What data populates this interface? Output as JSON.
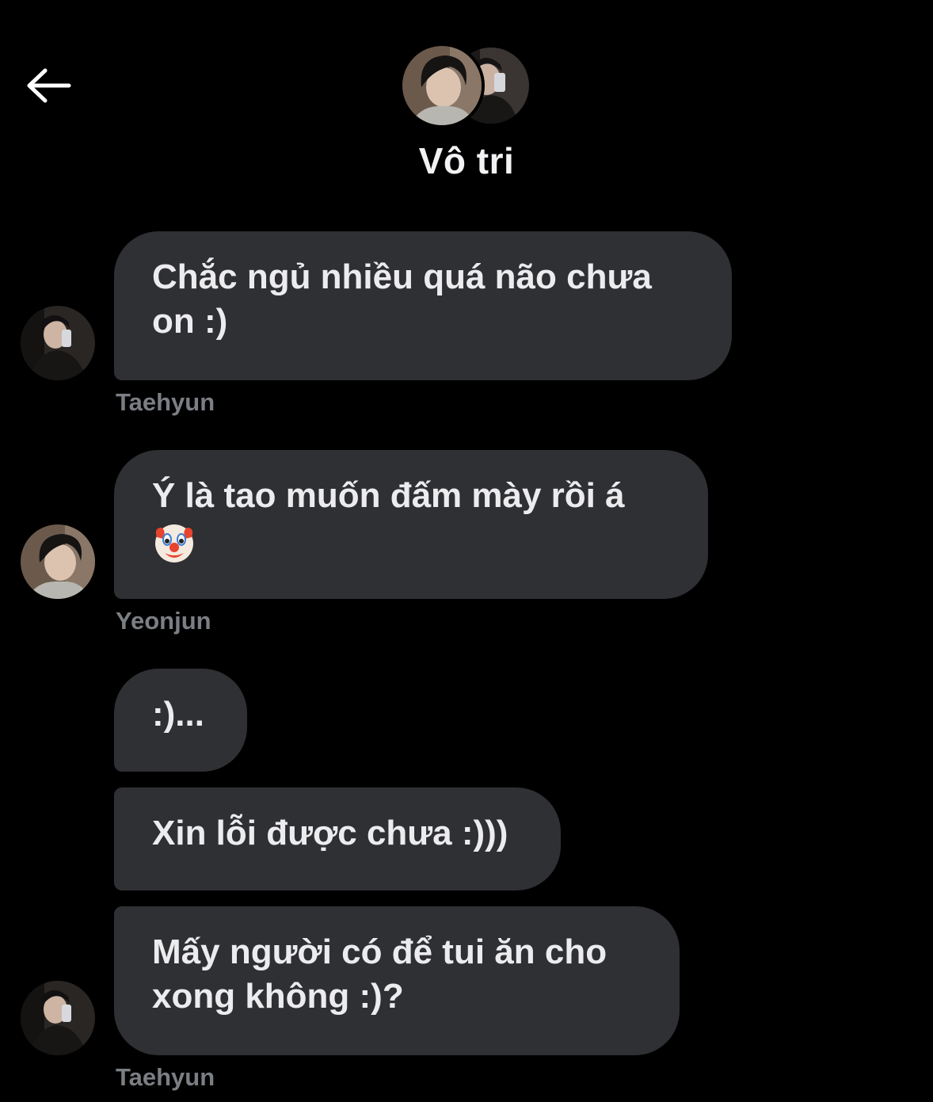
{
  "header": {
    "back_icon": "arrow-left-icon",
    "group_name": "Vô tri"
  },
  "colors": {
    "background": "#000000",
    "bubble": "#2f3033",
    "bubble_text": "#ececee",
    "sender_name": "#7b7e83"
  },
  "messages": [
    {
      "sender": "Taehyun",
      "lines": [
        "Chắc ngủ nhiều quá não chưa",
        "on :)"
      ]
    },
    {
      "sender": "Yeonjun",
      "lines": [
        "Ý là tao muốn đấm mày rồi á",
        ""
      ],
      "emoji": "clown-face-emoji"
    },
    {
      "sender": "Taehyun",
      "lines": [
        ":)..."
      ]
    },
    {
      "sender": "Taehyun",
      "lines": [
        "Xin lỗi được chưa :)))"
      ]
    },
    {
      "sender": "Taehyun",
      "lines": [
        "Mấy người có để tui ăn cho",
        "xong không :)?"
      ]
    }
  ]
}
